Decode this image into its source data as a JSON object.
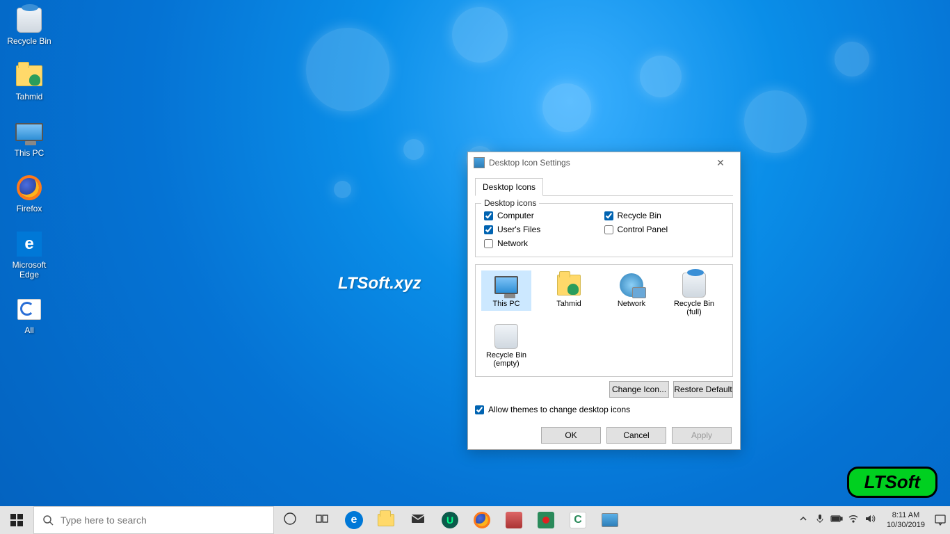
{
  "desktop_icons": [
    {
      "id": "recycle-bin",
      "label": "Recycle Bin",
      "icon": "bin-full"
    },
    {
      "id": "tahmid",
      "label": "Tahmid",
      "icon": "user-folder"
    },
    {
      "id": "this-pc",
      "label": "This PC",
      "icon": "pc"
    },
    {
      "id": "firefox",
      "label": "Firefox",
      "icon": "firefox"
    },
    {
      "id": "edge",
      "label": "Microsoft Edge",
      "icon": "edge"
    },
    {
      "id": "all",
      "label": "All",
      "icon": "all"
    }
  ],
  "wallpaper_text": "LTSoft.xyz",
  "badge_text": "LTSoft",
  "dialog": {
    "title": "Desktop Icon Settings",
    "tab": "Desktop Icons",
    "group_label": "Desktop icons",
    "checks_left": [
      {
        "label": "Computer",
        "checked": true
      },
      {
        "label": "User's Files",
        "checked": true
      },
      {
        "label": "Network",
        "checked": false
      }
    ],
    "checks_right": [
      {
        "label": "Recycle Bin",
        "checked": true
      },
      {
        "label": "Control Panel",
        "checked": false
      }
    ],
    "preview": [
      {
        "label": "This PC",
        "icon": "pc",
        "selected": true
      },
      {
        "label": "Tahmid",
        "icon": "user-folder"
      },
      {
        "label": "Network",
        "icon": "network"
      },
      {
        "label": "Recycle Bin (full)",
        "icon": "bin-full"
      },
      {
        "label": "Recycle Bin (empty)",
        "icon": "bin-empty"
      }
    ],
    "change_icon": "Change Icon...",
    "restore_default": "Restore Default",
    "allow_themes": "Allow themes to change desktop icons",
    "allow_checked": true,
    "ok": "OK",
    "cancel": "Cancel",
    "apply": "Apply"
  },
  "taskbar": {
    "search_placeholder": "Type here to search",
    "pinned": [
      "cortana-circle",
      "task-view",
      "edge",
      "file-explorer",
      "mail",
      "iobit",
      "firefox",
      "app1",
      "camtasia-rec",
      "camtasia",
      "desktop-slideshow"
    ],
    "tray": [
      "chevron-up",
      "mic",
      "battery",
      "wifi",
      "volume"
    ],
    "time": "8:11 AM",
    "date": "10/30/2019"
  }
}
